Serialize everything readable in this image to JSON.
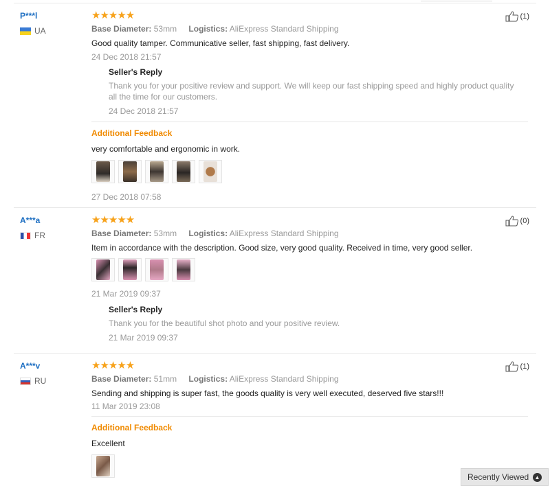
{
  "reviews": [
    {
      "user": "P***l",
      "country": "UA",
      "stars": "★★★★★",
      "likes": "(1)",
      "attr1_label": "Base Diameter:",
      "attr1_value": "53mm",
      "attr2_label": "Logistics:",
      "attr2_value": "AliExpress Standard Shipping",
      "text": "Good quality tamper. Communicative seller, fast shipping, fast delivery.",
      "date": "24 Dec 2018 21:57",
      "reply_title": "Seller's Reply",
      "reply_text": "Thank you for your positive review and support. We will keep our fast shipping speed and highly product quality all the time for our customers.",
      "reply_date": "24 Dec 2018 21:57",
      "additional_label": "Additional Feedback",
      "additional_text": "very comfortable and ergonomic in work.",
      "additional_date": "27 Dec 2018 07:58"
    },
    {
      "user": "A***a",
      "country": "FR",
      "stars": "★★★★★",
      "likes": "(0)",
      "attr1_label": "Base Diameter:",
      "attr1_value": "53mm",
      "attr2_label": "Logistics:",
      "attr2_value": "AliExpress Standard Shipping",
      "text": "Item in accordance with the description. Good size, very good quality. Received in time, very good seller.",
      "date": "21 Mar 2019 09:37",
      "reply_title": "Seller's Reply",
      "reply_text": "Thank you for the beautiful shot photo and your positive review.",
      "reply_date": "21 Mar 2019 09:37"
    },
    {
      "user": "A***v",
      "country": "RU",
      "stars": "★★★★★",
      "likes": "(1)",
      "attr1_label": "Base Diameter:",
      "attr1_value": "51mm",
      "attr2_label": "Logistics:",
      "attr2_value": "AliExpress Standard Shipping",
      "text": "Sending and shipping is super fast, the goods quality is very well executed, deserved five stars!!!",
      "date": "11 Mar 2019 23:08",
      "additional_label": "Additional Feedback",
      "additional_text": "Excellent"
    }
  ],
  "recently_viewed": "Recently Viewed",
  "colors": {
    "link": "#1e6fc2",
    "stars": "#f7a21b",
    "additional": "#f08a00"
  },
  "icons": [
    "thumbs-up-icon",
    "chevron-up-icon",
    "flag-icon"
  ]
}
